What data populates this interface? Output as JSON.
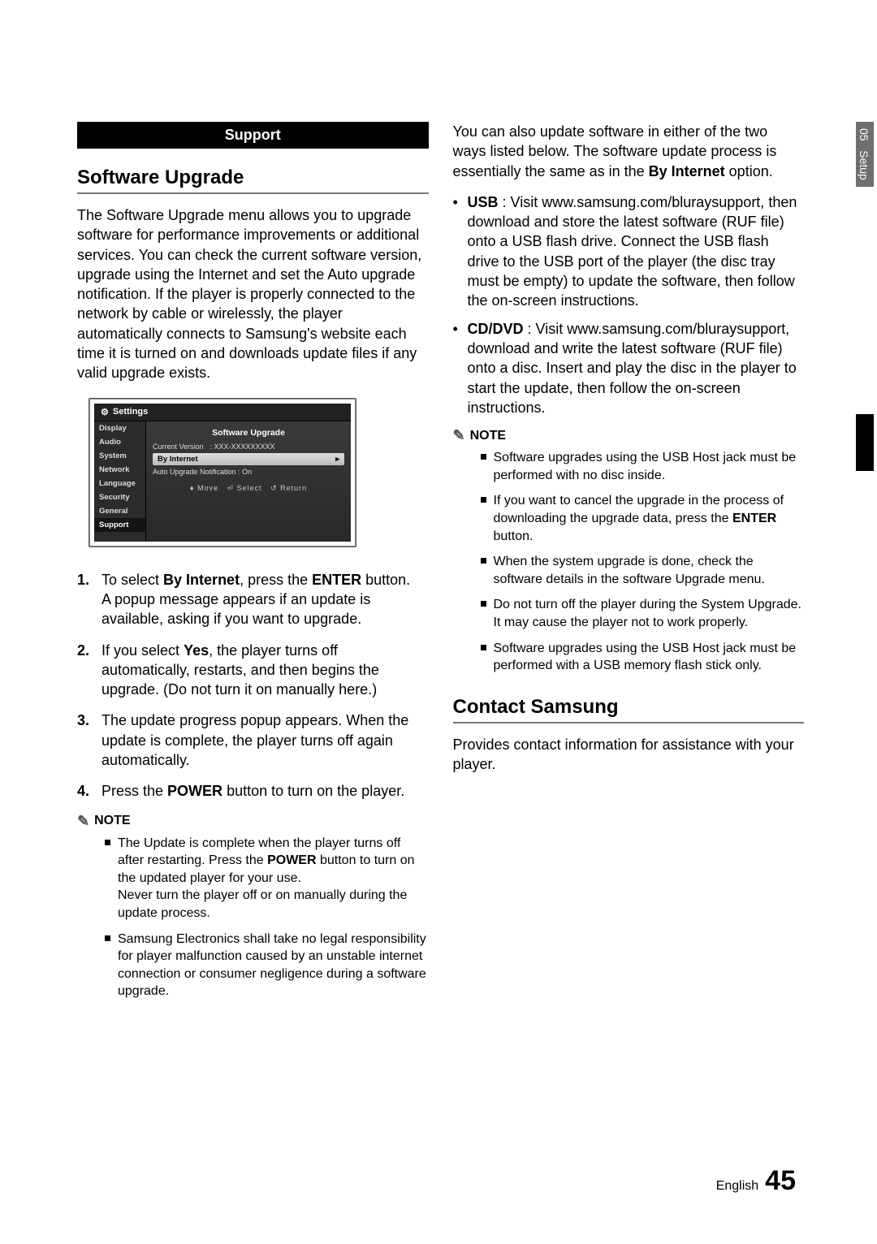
{
  "sideTab": {
    "chapter": "05",
    "section": "Setup"
  },
  "left": {
    "sectionBar": "Support",
    "h_software": "Software Upgrade",
    "intro": "The Software Upgrade menu allows you to upgrade software for performance improvements or additional services. You can check the current software version, upgrade using the Internet and set the Auto upgrade notification. If the player is properly connected to the network by cable or wirelessly, the player automatically connects to Samsung's website each time it is turned on and downloads update files if any valid upgrade exists.",
    "tv": {
      "title": "Settings",
      "side": [
        "Display",
        "Audio",
        "System",
        "Network",
        "Language",
        "Security",
        "General",
        "Support"
      ],
      "panelTitle": "Software Upgrade",
      "curVerLabel": "Current Version",
      "curVerVal": ": XXX-XXXXXXXXX",
      "opt1": "By Internet",
      "opt2": "Auto Upgrade Notification : On",
      "foot_move": "Move",
      "foot_select": "Select",
      "foot_return": "Return"
    },
    "steps": {
      "s1a": "To select ",
      "s1b": "By Internet",
      "s1c": ", press the ",
      "s1d": "ENTER",
      "s1e": " button.",
      "s1f": "A popup message appears if an update is available, asking if you want to upgrade.",
      "s2a": "If you select ",
      "s2b": "Yes",
      "s2c": ", the player turns off automatically, restarts, and then begins the upgrade. (Do not turn it on manually here.)",
      "s3": "The update progress popup appears. When the update is complete, the player turns off again automatically.",
      "s4a": "Press the ",
      "s4b": "POWER",
      "s4c": " button to turn on the player."
    },
    "noteLabel": "NOTE",
    "notes": {
      "n1a": "The Update is complete when the player turns off after restarting. Press the ",
      "n1b": "POWER",
      "n1c": " button to turn on the updated player for your use.",
      "n1d": "Never turn the player off or on manually during the update process.",
      "n2": "Samsung Electronics shall take no legal responsibility for player malfunction caused by an unstable internet connection or consumer negligence during a software upgrade."
    }
  },
  "right": {
    "para1a": "You can also update software in either of the two ways listed below. The software update process is essentially the same as in the ",
    "para1b": "By Internet",
    "para1c": " option.",
    "usb_label": "USB",
    "usb_text": " : Visit www.samsung.com/bluraysupport, then download and store the latest software (RUF file) onto a USB flash drive. Connect the USB flash drive to the USB port of the player (the disc tray must be empty) to update the software, then follow the on-screen instructions.",
    "cd_label": "CD/DVD",
    "cd_text": " : Visit www.samsung.com/bluraysupport, download and write the latest software (RUF file) onto a disc. Insert and play the disc in the player to start the update, then follow the on-screen instructions.",
    "noteLabel": "NOTE",
    "notes": {
      "n1": "Software upgrades using the USB Host jack must be performed with no disc inside.",
      "n2a": "If you want to cancel the upgrade in the process of downloading the upgrade data, press the ",
      "n2b": "ENTER",
      "n2c": " button.",
      "n3": "When the system upgrade is done, check the software details in the software Upgrade menu.",
      "n4": "Do not turn off the player during the System Upgrade. It may cause the player not to work properly.",
      "n5": "Software upgrades using the USB Host jack must be performed with a USB memory flash stick only."
    },
    "h_contact": "Contact Samsung",
    "contact_text": "Provides contact information for assistance with your player."
  },
  "footer": {
    "lang": "English",
    "page": "45"
  }
}
